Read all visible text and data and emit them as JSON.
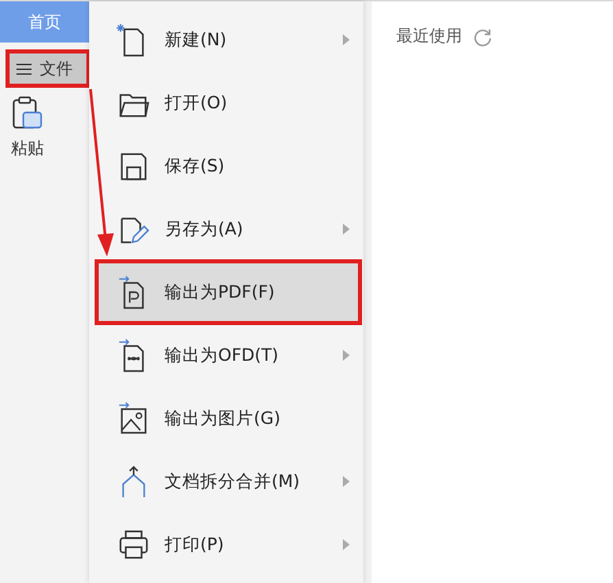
{
  "tab": {
    "label": "首页",
    "selected": true
  },
  "file_button": {
    "label": "文件",
    "annotated": true
  },
  "ribbon": {
    "paste_label": "粘贴"
  },
  "menu": {
    "items": [
      {
        "label": "新建(N)",
        "kind": "new",
        "submenu": true,
        "selected": false,
        "annotated": false
      },
      {
        "label": "打开(O)",
        "kind": "open",
        "submenu": false,
        "selected": false,
        "annotated": false
      },
      {
        "label": "保存(S)",
        "kind": "save",
        "submenu": false,
        "selected": false,
        "annotated": false
      },
      {
        "label": "另存为(A)",
        "kind": "saveas",
        "submenu": true,
        "selected": false,
        "annotated": false
      },
      {
        "label": "输出为PDF(F)",
        "kind": "pdf",
        "submenu": false,
        "selected": true,
        "annotated": true
      },
      {
        "label": "输出为OFD(T)",
        "kind": "ofd",
        "submenu": true,
        "selected": false,
        "annotated": false
      },
      {
        "label": "输出为图片(G)",
        "kind": "image",
        "submenu": false,
        "selected": false,
        "annotated": false
      },
      {
        "label": "文档拆分合并(M)",
        "kind": "split",
        "submenu": true,
        "selected": false,
        "annotated": false
      },
      {
        "label": "打印(P)",
        "kind": "print",
        "submenu": true,
        "selected": false,
        "annotated": false
      }
    ]
  },
  "recent": {
    "title": "最近使用"
  }
}
